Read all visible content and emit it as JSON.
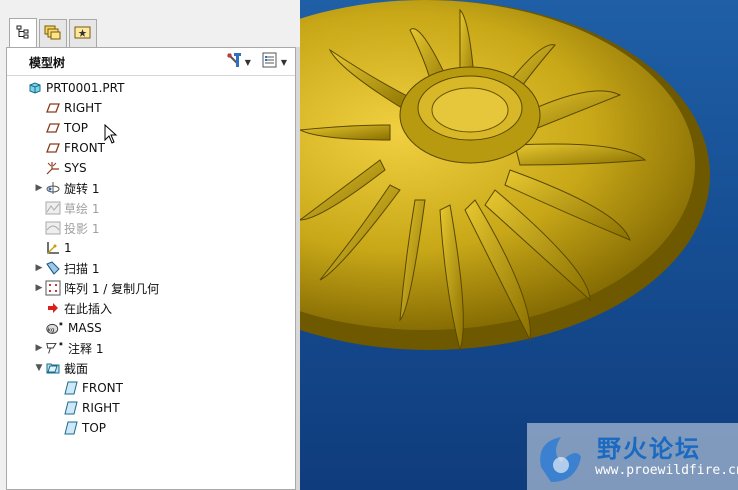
{
  "panel": {
    "title": "模型树"
  },
  "tabs": [
    {
      "icon": "model-tree-icon",
      "active": true
    },
    {
      "icon": "folder-browser-icon",
      "active": false
    },
    {
      "icon": "favorites-icon",
      "active": false
    }
  ],
  "tree": {
    "items": [
      {
        "label": "PRT0001.PRT",
        "icon": "part-icon",
        "indent": 0,
        "expander": "",
        "dim": false
      },
      {
        "label": "RIGHT",
        "icon": "datum-plane-icon",
        "indent": 1,
        "expander": "",
        "dim": false
      },
      {
        "label": "TOP",
        "icon": "datum-plane-icon",
        "indent": 1,
        "expander": "",
        "dim": false
      },
      {
        "label": "FRONT",
        "icon": "datum-plane-icon",
        "indent": 1,
        "expander": "",
        "dim": false
      },
      {
        "label": "SYS",
        "icon": "coordinate-system-icon",
        "indent": 1,
        "expander": "",
        "dim": false
      },
      {
        "label": "旋转 1",
        "icon": "revolve-icon",
        "indent": 1,
        "expander": "▶",
        "dim": false
      },
      {
        "label": "草绘 1",
        "icon": "sketch-icon",
        "indent": 1,
        "expander": "",
        "dim": true
      },
      {
        "label": "投影 1",
        "icon": "projection-icon",
        "indent": 1,
        "expander": "",
        "dim": true
      },
      {
        "label": "1",
        "icon": "datum-coordinate-icon",
        "indent": 1,
        "expander": "",
        "dim": false
      },
      {
        "label": "扫描 1",
        "icon": "sweep-icon",
        "indent": 1,
        "expander": "▶",
        "dim": false
      },
      {
        "label": "阵列 1 / 复制几何",
        "icon": "pattern-icon",
        "indent": 1,
        "expander": "▶",
        "dim": false
      },
      {
        "label": "在此插入",
        "icon": "insert-here-arrow-icon",
        "indent": 1,
        "expander": "",
        "dim": false
      },
      {
        "label": "MASS",
        "icon": "mass-analysis-icon",
        "indent": 1,
        "expander": "",
        "dim": false
      },
      {
        "label": "注释 1",
        "icon": "annotation-icon",
        "indent": 1,
        "expander": "▶",
        "dim": false
      },
      {
        "label": "截面",
        "icon": "section-folder-icon",
        "indent": 1,
        "expander": "▼",
        "dim": false
      },
      {
        "label": "FRONT",
        "icon": "section-icon",
        "indent": 2,
        "expander": "",
        "dim": false
      },
      {
        "label": "RIGHT",
        "icon": "section-icon",
        "indent": 2,
        "expander": "",
        "dim": false
      },
      {
        "label": "TOP",
        "icon": "section-icon",
        "indent": 2,
        "expander": "",
        "dim": false
      }
    ]
  },
  "watermark": {
    "title": "野火论坛",
    "url": "www.proewildfire.cn"
  },
  "colors": {
    "viewport_bg": "#1a56a0",
    "model_gold": "#c9a818"
  }
}
